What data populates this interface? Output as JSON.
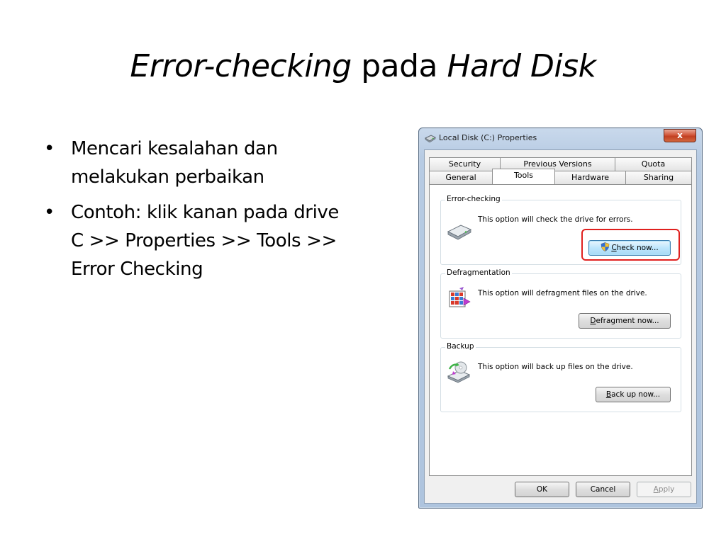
{
  "slide": {
    "title_part1": "Error-checking",
    "title_part2": " pada ",
    "title_part3": "Hard Disk",
    "bullets": [
      "Mencari kesalahan dan melakukan perbaikan",
      "Contoh: klik kanan pada drive C >> Properties >> Tools >> Error Checking"
    ]
  },
  "dialog": {
    "title": "Local Disk (C:) Properties",
    "close_label": "x",
    "tabs_row1": [
      "Security",
      "Previous Versions",
      "Quota"
    ],
    "tabs_row2": [
      "General",
      "Tools",
      "Hardware",
      "Sharing"
    ],
    "active_tab": "Tools",
    "groups": {
      "error_checking": {
        "label": "Error-checking",
        "text": "This option will check the drive for errors.",
        "button_hotkey": "C",
        "button_rest": "heck now..."
      },
      "defragmentation": {
        "label": "Defragmentation",
        "text": "This option will defragment files on the drive.",
        "button_hotkey": "D",
        "button_rest": "efragment now..."
      },
      "backup": {
        "label": "Backup",
        "text": "This option will back up files on the drive.",
        "button_hotkey": "B",
        "button_rest": "ack up now..."
      }
    },
    "footer": {
      "ok": "OK",
      "cancel": "Cancel",
      "apply_hotkey": "A",
      "apply_rest": "pply"
    }
  },
  "colors": {
    "highlight": "#e0201e",
    "window_frame": "#b7cbe3",
    "close_button": "#c23f22"
  }
}
